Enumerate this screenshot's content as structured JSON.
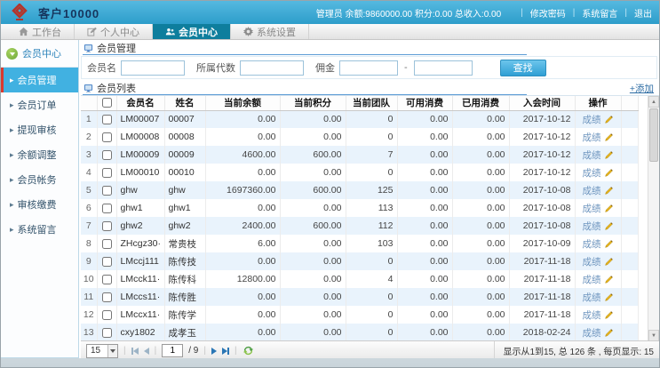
{
  "header": {
    "title": "客户10000",
    "admin_info": "管理员 余额:9860000.00 积分:0.00 总收入:0.00",
    "links": {
      "change_password": "修改密码",
      "system_message": "系统留言",
      "logout": "退出"
    }
  },
  "tabs": [
    {
      "label": "工作台",
      "icon": "home-icon",
      "active": false
    },
    {
      "label": "个人中心",
      "icon": "edit-icon",
      "active": false
    },
    {
      "label": "会员中心",
      "icon": "users-icon",
      "active": true
    },
    {
      "label": "系统设置",
      "icon": "gear-icon",
      "active": false
    }
  ],
  "sidebar": {
    "header": "会员中心",
    "items": [
      {
        "label": "会员管理",
        "active": true
      },
      {
        "label": "会员订单",
        "active": false
      },
      {
        "label": "提现审核",
        "active": false
      },
      {
        "label": "余额调整",
        "active": false
      },
      {
        "label": "会员帐务",
        "active": false
      },
      {
        "label": "审核缴费",
        "active": false
      },
      {
        "label": "系统留言",
        "active": false
      }
    ]
  },
  "search": {
    "section_title": "会员管理",
    "fields": [
      {
        "label": "会员名"
      },
      {
        "label": "所属代数"
      },
      {
        "label": "佣金"
      }
    ],
    "range_separator": "-",
    "button_label": "查找"
  },
  "list": {
    "section_title": "会员列表",
    "add_link": "+添加",
    "columns": [
      "会员名",
      "姓名",
      "当前余额",
      "当前积分",
      "当前团队",
      "可用消费",
      "已用消费",
      "入会时间",
      "操作",
      ""
    ],
    "action_label": "成绩",
    "rows": [
      {
        "id": "LM00007",
        "name": "00007",
        "balance": "0.00",
        "points": "0.00",
        "team": "0",
        "available": "0.00",
        "used": "0.00",
        "date": "2017-10-12"
      },
      {
        "id": "LM00008",
        "name": "00008",
        "balance": "0.00",
        "points": "0.00",
        "team": "0",
        "available": "0.00",
        "used": "0.00",
        "date": "2017-10-12"
      },
      {
        "id": "LM00009",
        "name": "00009",
        "balance": "4600.00",
        "points": "600.00",
        "team": "7",
        "available": "0.00",
        "used": "0.00",
        "date": "2017-10-12"
      },
      {
        "id": "LM00010",
        "name": "00010",
        "balance": "0.00",
        "points": "0.00",
        "team": "0",
        "available": "0.00",
        "used": "0.00",
        "date": "2017-10-12"
      },
      {
        "id": "ghw",
        "name": "ghw",
        "balance": "1697360.00",
        "points": "600.00",
        "team": "125",
        "available": "0.00",
        "used": "0.00",
        "date": "2017-10-08"
      },
      {
        "id": "ghw1",
        "name": "ghw1",
        "balance": "0.00",
        "points": "0.00",
        "team": "113",
        "available": "0.00",
        "used": "0.00",
        "date": "2017-10-08"
      },
      {
        "id": "ghw2",
        "name": "ghw2",
        "balance": "2400.00",
        "points": "600.00",
        "team": "112",
        "available": "0.00",
        "used": "0.00",
        "date": "2017-10-08"
      },
      {
        "id": "ZHcgz30·",
        "name": "常贵枝",
        "balance": "6.00",
        "points": "0.00",
        "team": "103",
        "available": "0.00",
        "used": "0.00",
        "date": "2017-10-09"
      },
      {
        "id": "LMccj111",
        "name": "陈传技",
        "balance": "0.00",
        "points": "0.00",
        "team": "0",
        "available": "0.00",
        "used": "0.00",
        "date": "2017-11-18"
      },
      {
        "id": "LMcck11·",
        "name": "陈传科",
        "balance": "12800.00",
        "points": "0.00",
        "team": "4",
        "available": "0.00",
        "used": "0.00",
        "date": "2017-11-18"
      },
      {
        "id": "LMccs11·",
        "name": "陈传胜",
        "balance": "0.00",
        "points": "0.00",
        "team": "0",
        "available": "0.00",
        "used": "0.00",
        "date": "2017-11-18"
      },
      {
        "id": "LMccx11·",
        "name": "陈传学",
        "balance": "0.00",
        "points": "0.00",
        "team": "0",
        "available": "0.00",
        "used": "0.00",
        "date": "2017-11-18"
      },
      {
        "id": "cxy1802",
        "name": "成孝玉",
        "balance": "0.00",
        "points": "0.00",
        "team": "0",
        "available": "0.00",
        "used": "0.00",
        "date": "2018-02-24"
      }
    ]
  },
  "pagination": {
    "page_size": "15",
    "current_page": "1",
    "total_pages": "/ 9",
    "status": "显示从1到15, 总 126 条 , 每页显示: 15"
  }
}
